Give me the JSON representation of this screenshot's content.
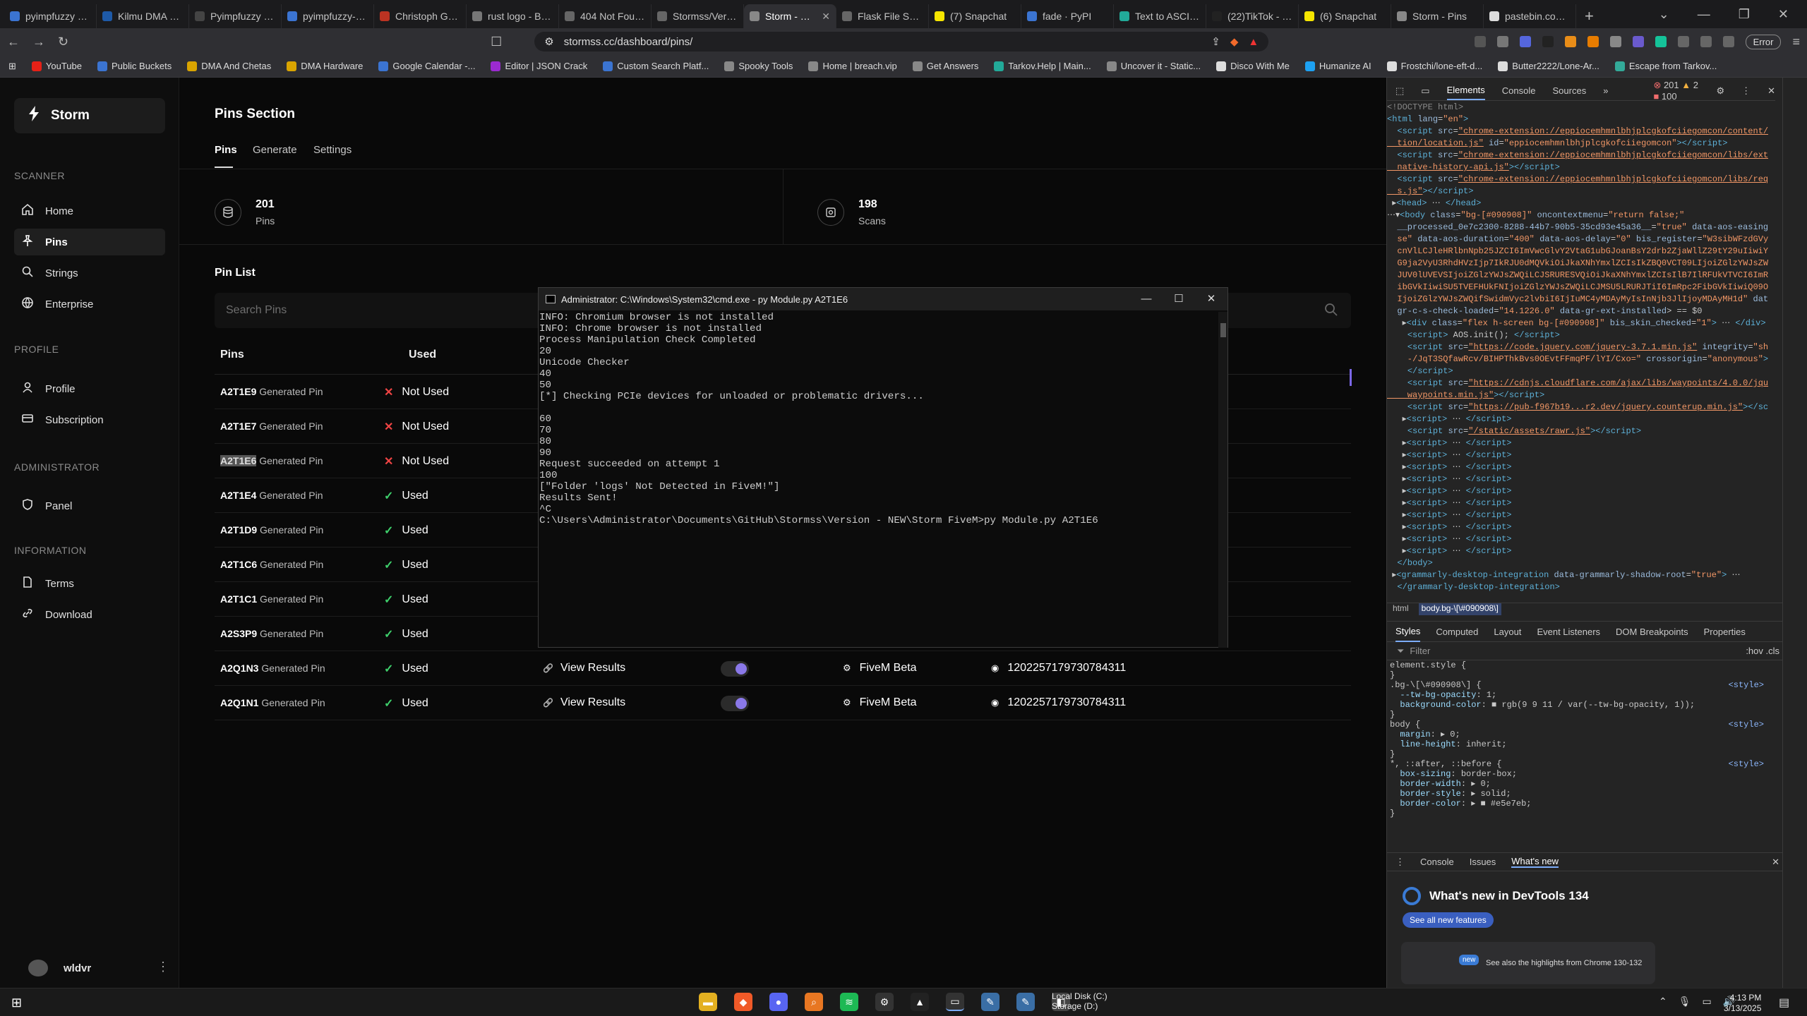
{
  "browser": {
    "tabs": [
      {
        "label": "pyimpfuzzy · PyPI",
        "color": "#3b74d1"
      },
      {
        "label": "Kilmu DMA Panel",
        "color": "#1e5aa8"
      },
      {
        "label": "Pyimpfuzzy build",
        "color": "#444"
      },
      {
        "label": "pyimpfuzzy-windows",
        "color": "#3b74d1"
      },
      {
        "label": "Christoph Gohlke",
        "color": "#b32"
      },
      {
        "label": "rust logo - Brave",
        "color": "#777"
      },
      {
        "label": "404 Not Found",
        "color": "#666"
      },
      {
        "label": "Stormss/Version",
        "color": "#666"
      },
      {
        "label": "Storm - Pins",
        "color": "#888",
        "active": true
      },
      {
        "label": "Flask File Serving",
        "color": "#666"
      },
      {
        "label": "(7) Snapchat",
        "color": "#f7e600"
      },
      {
        "label": "fade · PyPI",
        "color": "#3b74d1"
      },
      {
        "label": "Text to ASCII Art",
        "color": "#2a9"
      },
      {
        "label": "(22)TikTok - Make",
        "color": "#222"
      },
      {
        "label": "(6) Snapchat",
        "color": "#f7e600"
      },
      {
        "label": "Storm - Pins",
        "color": "#888"
      },
      {
        "label": "pastebin.com/raw",
        "color": "#ddd"
      }
    ],
    "url": "stormss.cc/dashboard/pins/",
    "error_label": "Error",
    "bookmarks": [
      {
        "label": "YouTube",
        "color": "#e62117"
      },
      {
        "label": "Public Buckets",
        "color": "#3b74d1"
      },
      {
        "label": "DMA And Chetas",
        "color": "#d9a400"
      },
      {
        "label": "DMA Hardware",
        "color": "#d9a400"
      },
      {
        "label": "Google Calendar -...",
        "color": "#3b74d1"
      },
      {
        "label": "Editor | JSON Crack",
        "color": "#9b2ad1"
      },
      {
        "label": "Custom Search Platf...",
        "color": "#3b74d1"
      },
      {
        "label": "Spooky Tools",
        "color": "#888"
      },
      {
        "label": "Home | breach.vip",
        "color": "#888"
      },
      {
        "label": "Get Answers",
        "color": "#888"
      },
      {
        "label": "Tarkov.Help | Main...",
        "color": "#2a9"
      },
      {
        "label": "Uncover it - Static...",
        "color": "#888"
      },
      {
        "label": "Disco With Me",
        "color": "#ddd"
      },
      {
        "label": "Humanize AI",
        "color": "#1da1f2"
      },
      {
        "label": "Frostchi/lone-eft-d...",
        "color": "#ddd"
      },
      {
        "label": "Butter2222/Lone-Ar...",
        "color": "#ddd"
      },
      {
        "label": "Escape from Tarkov...",
        "color": "#3a9"
      }
    ]
  },
  "app": {
    "brand": "Storm",
    "sections": {
      "scanner": "SCANNER",
      "profile": "PROFILE",
      "admin": "ADMINISTRATOR",
      "info": "INFORMATION"
    },
    "nav": {
      "home": "Home",
      "pins": "Pins",
      "strings": "Strings",
      "enterprise": "Enterprise",
      "profile": "Profile",
      "subscription": "Subscription",
      "panel": "Panel",
      "terms": "Terms",
      "download": "Download"
    },
    "user": "wldvr",
    "page_title": "Pins Section",
    "tabs": {
      "pins": "Pins",
      "generate": "Generate",
      "settings": "Settings"
    },
    "stats": {
      "pins_value": "201",
      "pins_label": "Pins",
      "scans_value": "198",
      "scans_label": "Scans"
    },
    "list_title": "Pin List",
    "search_placeholder": "Search Pins",
    "columns": {
      "pins": "Pins",
      "used": "Used"
    },
    "generated_label": "Generated Pin",
    "rows": [
      {
        "pin": "A2T1E9",
        "status": "Not Used",
        "used": false
      },
      {
        "pin": "A2T1E7",
        "status": "Not Used",
        "used": false
      },
      {
        "pin": "A2T1E6",
        "status": "Not Used",
        "used": false,
        "highlight": true
      },
      {
        "pin": "A2T1E4",
        "status": "Used",
        "used": true
      },
      {
        "pin": "A2T1D9",
        "status": "Used",
        "used": true
      },
      {
        "pin": "A2T1C6",
        "status": "Used",
        "used": true
      },
      {
        "pin": "A2T1C1",
        "status": "Used",
        "used": true
      },
      {
        "pin": "A2S3P9",
        "status": "Used",
        "used": true
      },
      {
        "pin": "A2Q1N3",
        "status": "Used",
        "used": true,
        "results": "View Results",
        "game": "FiveM Beta",
        "discord": "1202257179730784311"
      },
      {
        "pin": "A2Q1N1",
        "status": "Used",
        "used": true,
        "results": "View Results",
        "game": "FiveM Beta",
        "discord": "1202257179730784311"
      }
    ]
  },
  "cmd": {
    "title": "Administrator: C:\\Windows\\System32\\cmd.exe - py  Module.py A2T1E6",
    "lines": [
      "INFO: Chromium browser is not installed",
      "INFO: Chrome browser is not installed",
      "Process Manipulation Check Completed",
      "20",
      "Unicode Checker",
      "40",
      "50",
      "[*] Checking PCIe devices for unloaded or problematic drivers...",
      "",
      "60",
      "70",
      "80",
      "90",
      "Request succeeded on attempt 1",
      "100",
      "[\"Folder 'logs' Not Detected in FiveM!\"]",
      "Results Sent!",
      "^C",
      "C:\\Users\\Administrator\\Documents\\GitHub\\Stormss\\Version - NEW\\Storm FiveM>py Module.py A2T1E6"
    ]
  },
  "devtools": {
    "tabs": {
      "elements": "Elements",
      "console": "Console",
      "sources": "Sources"
    },
    "errors": "201",
    "warnings": "2",
    "issues": "100",
    "breadcrumb": {
      "html": "html",
      "body": "body.bg-\\[\\#090908\\]"
    },
    "subtabs": [
      "Styles",
      "Computed",
      "Layout",
      "Event Listeners",
      "DOM Breakpoints",
      "Properties"
    ],
    "filter_placeholder": "Filter",
    "filter_tools": ":hov  .cls",
    "drawer_tabs": {
      "console": "Console",
      "issues": "Issues",
      "whatsnew": "What's new"
    },
    "whatsnew_title": "What's new in DevTools 134",
    "see_all": "See all new features",
    "card_text": "See also the highlights from Chrome 130-132",
    "new_badge": "new"
  },
  "taskbar": {
    "drive": "Local Disk (C:)",
    "drive2": "Storage (D:)",
    "time": "4:13 PM",
    "date": "3/13/2025"
  }
}
